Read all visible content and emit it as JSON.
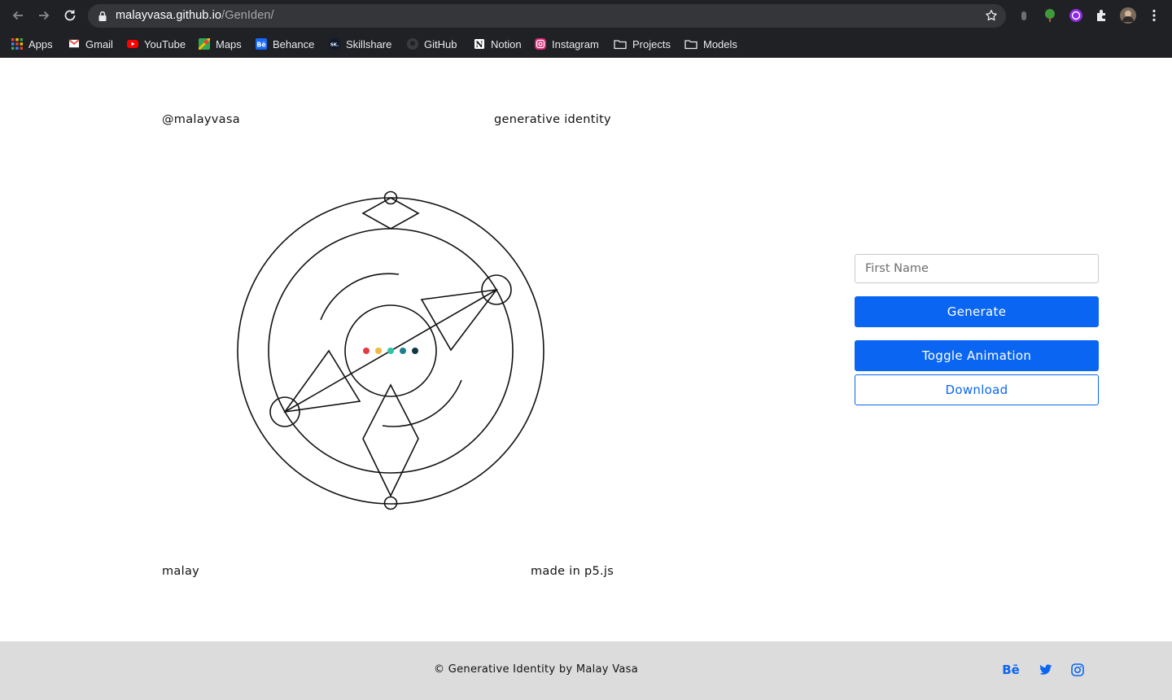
{
  "browser": {
    "url_host": "malayvasa.github.io",
    "url_path": "/GenIden/",
    "bookmarks": [
      {
        "label": "Apps",
        "icon": "apps-grid-icon"
      },
      {
        "label": "Gmail",
        "icon": "gmail-icon"
      },
      {
        "label": "YouTube",
        "icon": "youtube-icon"
      },
      {
        "label": "Maps",
        "icon": "maps-icon"
      },
      {
        "label": "Behance",
        "icon": "behance-icon"
      },
      {
        "label": "Skillshare",
        "icon": "skillshare-icon"
      },
      {
        "label": "GitHub",
        "icon": "github-icon"
      },
      {
        "label": "Notion",
        "icon": "notion-icon"
      },
      {
        "label": "Instagram",
        "icon": "instagram-icon"
      },
      {
        "label": "Projects",
        "icon": "folder-icon"
      },
      {
        "label": "Models",
        "icon": "folder-icon"
      }
    ]
  },
  "page": {
    "handle": "@malayvasa",
    "title": "generative identity",
    "name_label": "malay",
    "credit": "made in p5.js"
  },
  "form": {
    "first_name_placeholder": "First Name",
    "first_name_value": "",
    "generate_label": "Generate",
    "toggle_label": "Toggle Animation",
    "download_label": "Download"
  },
  "artwork": {
    "dot_colors": [
      "#e63946",
      "#f4b942",
      "#2ec4a6",
      "#1b7f8f",
      "#143642"
    ]
  },
  "footer": {
    "copyright": "© Generative Identity by Malay Vasa",
    "behance_label": "Bē"
  },
  "colors": {
    "accent": "#0a66f2",
    "chrome_bg": "#202124",
    "footer_bg": "#dcdcdc"
  }
}
